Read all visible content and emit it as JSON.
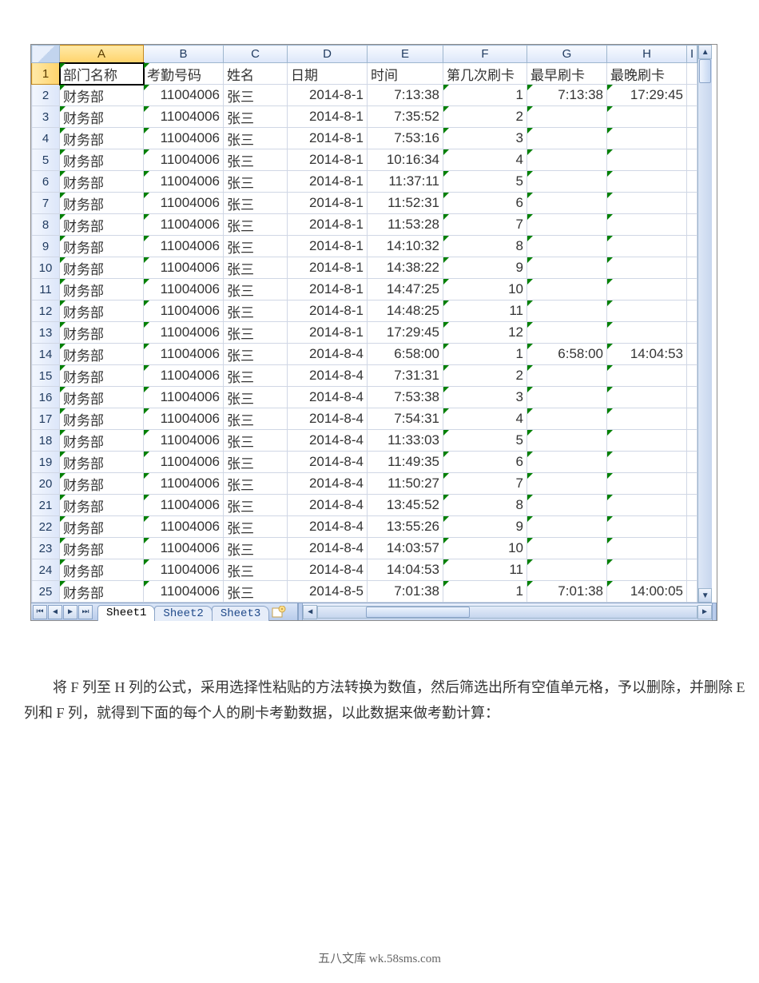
{
  "columns": [
    "A",
    "B",
    "C",
    "D",
    "E",
    "F",
    "G",
    "H",
    "I"
  ],
  "selected_column_index": 0,
  "active_cell": {
    "row": 1,
    "col": 0
  },
  "headers": [
    "部门名称",
    "考勤号码",
    "姓名",
    "日期",
    "时间",
    "第几次刷卡",
    "最早刷卡",
    "最晚刷卡"
  ],
  "rows": [
    {
      "n": 2,
      "dept": "财务部",
      "code": "11004006",
      "name": "张三",
      "date": "2014-8-1",
      "time": "7:13:38",
      "seq": "1",
      "earliest": "7:13:38",
      "latest": "17:29:45"
    },
    {
      "n": 3,
      "dept": "财务部",
      "code": "11004006",
      "name": "张三",
      "date": "2014-8-1",
      "time": "7:35:52",
      "seq": "2",
      "earliest": "",
      "latest": ""
    },
    {
      "n": 4,
      "dept": "财务部",
      "code": "11004006",
      "name": "张三",
      "date": "2014-8-1",
      "time": "7:53:16",
      "seq": "3",
      "earliest": "",
      "latest": ""
    },
    {
      "n": 5,
      "dept": "财务部",
      "code": "11004006",
      "name": "张三",
      "date": "2014-8-1",
      "time": "10:16:34",
      "seq": "4",
      "earliest": "",
      "latest": ""
    },
    {
      "n": 6,
      "dept": "财务部",
      "code": "11004006",
      "name": "张三",
      "date": "2014-8-1",
      "time": "11:37:11",
      "seq": "5",
      "earliest": "",
      "latest": ""
    },
    {
      "n": 7,
      "dept": "财务部",
      "code": "11004006",
      "name": "张三",
      "date": "2014-8-1",
      "time": "11:52:31",
      "seq": "6",
      "earliest": "",
      "latest": ""
    },
    {
      "n": 8,
      "dept": "财务部",
      "code": "11004006",
      "name": "张三",
      "date": "2014-8-1",
      "time": "11:53:28",
      "seq": "7",
      "earliest": "",
      "latest": ""
    },
    {
      "n": 9,
      "dept": "财务部",
      "code": "11004006",
      "name": "张三",
      "date": "2014-8-1",
      "time": "14:10:32",
      "seq": "8",
      "earliest": "",
      "latest": ""
    },
    {
      "n": 10,
      "dept": "财务部",
      "code": "11004006",
      "name": "张三",
      "date": "2014-8-1",
      "time": "14:38:22",
      "seq": "9",
      "earliest": "",
      "latest": ""
    },
    {
      "n": 11,
      "dept": "财务部",
      "code": "11004006",
      "name": "张三",
      "date": "2014-8-1",
      "time": "14:47:25",
      "seq": "10",
      "earliest": "",
      "latest": ""
    },
    {
      "n": 12,
      "dept": "财务部",
      "code": "11004006",
      "name": "张三",
      "date": "2014-8-1",
      "time": "14:48:25",
      "seq": "11",
      "earliest": "",
      "latest": ""
    },
    {
      "n": 13,
      "dept": "财务部",
      "code": "11004006",
      "name": "张三",
      "date": "2014-8-1",
      "time": "17:29:45",
      "seq": "12",
      "earliest": "",
      "latest": ""
    },
    {
      "n": 14,
      "dept": "财务部",
      "code": "11004006",
      "name": "张三",
      "date": "2014-8-4",
      "time": "6:58:00",
      "seq": "1",
      "earliest": "6:58:00",
      "latest": "14:04:53"
    },
    {
      "n": 15,
      "dept": "财务部",
      "code": "11004006",
      "name": "张三",
      "date": "2014-8-4",
      "time": "7:31:31",
      "seq": "2",
      "earliest": "",
      "latest": ""
    },
    {
      "n": 16,
      "dept": "财务部",
      "code": "11004006",
      "name": "张三",
      "date": "2014-8-4",
      "time": "7:53:38",
      "seq": "3",
      "earliest": "",
      "latest": ""
    },
    {
      "n": 17,
      "dept": "财务部",
      "code": "11004006",
      "name": "张三",
      "date": "2014-8-4",
      "time": "7:54:31",
      "seq": "4",
      "earliest": "",
      "latest": ""
    },
    {
      "n": 18,
      "dept": "财务部",
      "code": "11004006",
      "name": "张三",
      "date": "2014-8-4",
      "time": "11:33:03",
      "seq": "5",
      "earliest": "",
      "latest": ""
    },
    {
      "n": 19,
      "dept": "财务部",
      "code": "11004006",
      "name": "张三",
      "date": "2014-8-4",
      "time": "11:49:35",
      "seq": "6",
      "earliest": "",
      "latest": ""
    },
    {
      "n": 20,
      "dept": "财务部",
      "code": "11004006",
      "name": "张三",
      "date": "2014-8-4",
      "time": "11:50:27",
      "seq": "7",
      "earliest": "",
      "latest": ""
    },
    {
      "n": 21,
      "dept": "财务部",
      "code": "11004006",
      "name": "张三",
      "date": "2014-8-4",
      "time": "13:45:52",
      "seq": "8",
      "earliest": "",
      "latest": ""
    },
    {
      "n": 22,
      "dept": "财务部",
      "code": "11004006",
      "name": "张三",
      "date": "2014-8-4",
      "time": "13:55:26",
      "seq": "9",
      "earliest": "",
      "latest": ""
    },
    {
      "n": 23,
      "dept": "财务部",
      "code": "11004006",
      "name": "张三",
      "date": "2014-8-4",
      "time": "14:03:57",
      "seq": "10",
      "earliest": "",
      "latest": ""
    },
    {
      "n": 24,
      "dept": "财务部",
      "code": "11004006",
      "name": "张三",
      "date": "2014-8-4",
      "time": "14:04:53",
      "seq": "11",
      "earliest": "",
      "latest": ""
    },
    {
      "n": 25,
      "dept": "财务部",
      "code": "11004006",
      "name": "张三",
      "date": "2014-8-5",
      "time": "7:01:38",
      "seq": "1",
      "earliest": "7:01:38",
      "latest": "14:00:05"
    }
  ],
  "sheet_tabs": [
    "Sheet1",
    "Sheet2",
    "Sheet3"
  ],
  "active_sheet": 0,
  "paragraph": "将 F 列至 H 列的公式，采用选择性粘贴的方法转换为数值，然后筛选出所有空值单元格，予以删除，并删除 E 列和 F 列，就得到下面的每个人的刷卡考勤数据，以此数据来做考勤计算：",
  "footer": "五八文库 wk.58sms.com"
}
